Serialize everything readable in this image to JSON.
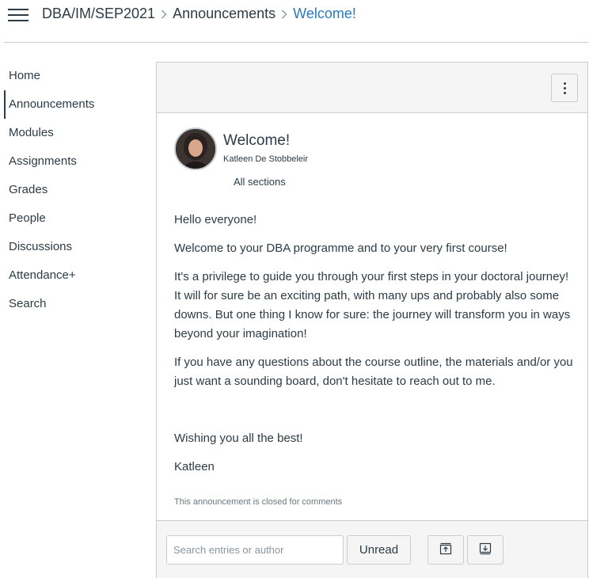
{
  "header": {
    "menu_icon": "hamburger-icon",
    "breadcrumbs": [
      "DBA/IM/SEP2021",
      "Announcements",
      "Welcome!"
    ],
    "separator_icon": "chevron-right-icon"
  },
  "sidebar": {
    "items": [
      {
        "label": "Home"
      },
      {
        "label": "Announcements",
        "active": true
      },
      {
        "label": "Modules"
      },
      {
        "label": "Assignments"
      },
      {
        "label": "Grades"
      },
      {
        "label": "People"
      },
      {
        "label": "Discussions"
      },
      {
        "label": "Attendance+"
      },
      {
        "label": "Search"
      }
    ]
  },
  "post": {
    "options_icon": "kebab-menu-icon",
    "title": "Welcome!",
    "author": "Katleen De Stobbeleir",
    "sections": "All sections",
    "paragraphs": [
      "Hello everyone!",
      "Welcome to your DBA programme and to your very first course!",
      "It's a privilege to guide you through your first steps in your doctoral journey! It will for sure be an exciting path, with many ups and probably also some downs. But one thing I know for sure: the journey will transform you in ways beyond your imagination!",
      "If you have any questions about the course outline, the materials and/or you just want a sounding board, don't hesitate to reach out to me."
    ],
    "closing": "Wishing you all the best!",
    "signature": "Katleen",
    "closed_note": "This announcement is closed for comments"
  },
  "footer": {
    "search_placeholder": "Search entries or author",
    "unread_label": "Unread",
    "collapse_icon": "arrow-up-box-icon",
    "expand_icon": "arrow-down-box-icon"
  },
  "colors": {
    "text": "#2d3b45",
    "link": "#2b7abc",
    "border": "#c7cdd1",
    "panel_bg": "#f5f5f5"
  }
}
